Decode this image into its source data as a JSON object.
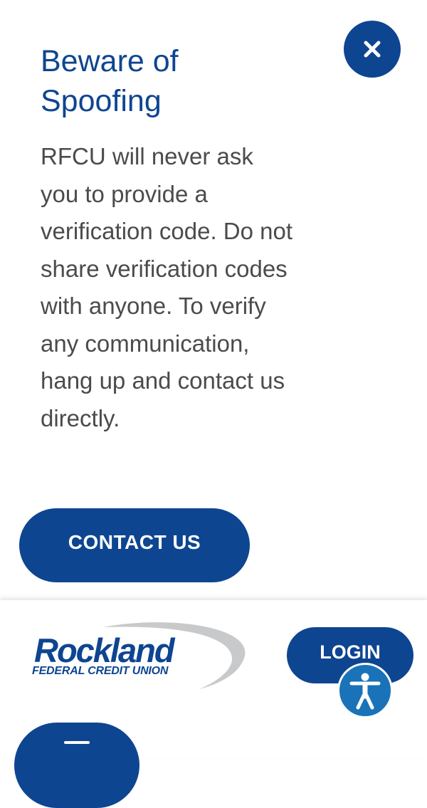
{
  "alert": {
    "title": "Beware of Spoofing",
    "body": "RFCU will never ask you to provide a verification code. Do not share verification codes with anyone. To verify any communication, hang up and contact us directly.",
    "contact_button": "CONTACT US",
    "close_icon": "close-icon"
  },
  "header": {
    "logo": {
      "name": "Rockland",
      "subtitle": "FEDERAL CREDIT UNION"
    },
    "login_button": "LOGIN",
    "accessibility_icon": "accessibility-icon",
    "menu_icon": "hamburger-menu-icon"
  },
  "colors": {
    "brand_blue": "#0e4591",
    "accessibility_blue": "#1a73b8",
    "body_text": "#4b4b4b",
    "logo_swoosh": "#c8c9cb"
  }
}
